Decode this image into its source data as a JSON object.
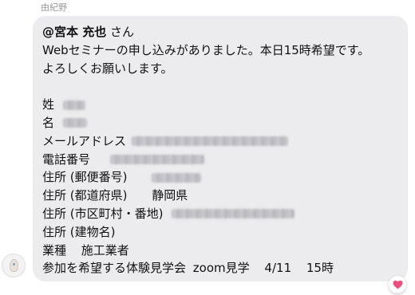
{
  "sender": {
    "name": "由紀野"
  },
  "message": {
    "mention": "@宮本 充也",
    "mention_suffix": " さん",
    "line1": "Webセミナーの申し込みがありました。本日15時希望です。",
    "line2": "よろしくお願いします。",
    "fields": {
      "last_name_label": "姓",
      "first_name_label": "名",
      "email_label": "メールアドレス",
      "phone_label": "電話番号",
      "postal_label": "住所 (郵便番号)",
      "prefecture_label": "住所 (都道府県)",
      "prefecture_value": "静岡県",
      "city_label": "住所 (市区町村・番地)",
      "building_label": "住所 (建物名)",
      "industry_label": "業種",
      "industry_value": "施工業者",
      "event_label": "参加を希望する体験見学会",
      "event_value": "zoom見学",
      "event_date": "4/11",
      "event_time": "15時"
    }
  },
  "reaction": {
    "icon": "heart-icon",
    "color": "#ef4f7f"
  },
  "colors": {
    "bubble": "#ececee",
    "sender_name": "#9a9a9a",
    "text": "#111111"
  }
}
